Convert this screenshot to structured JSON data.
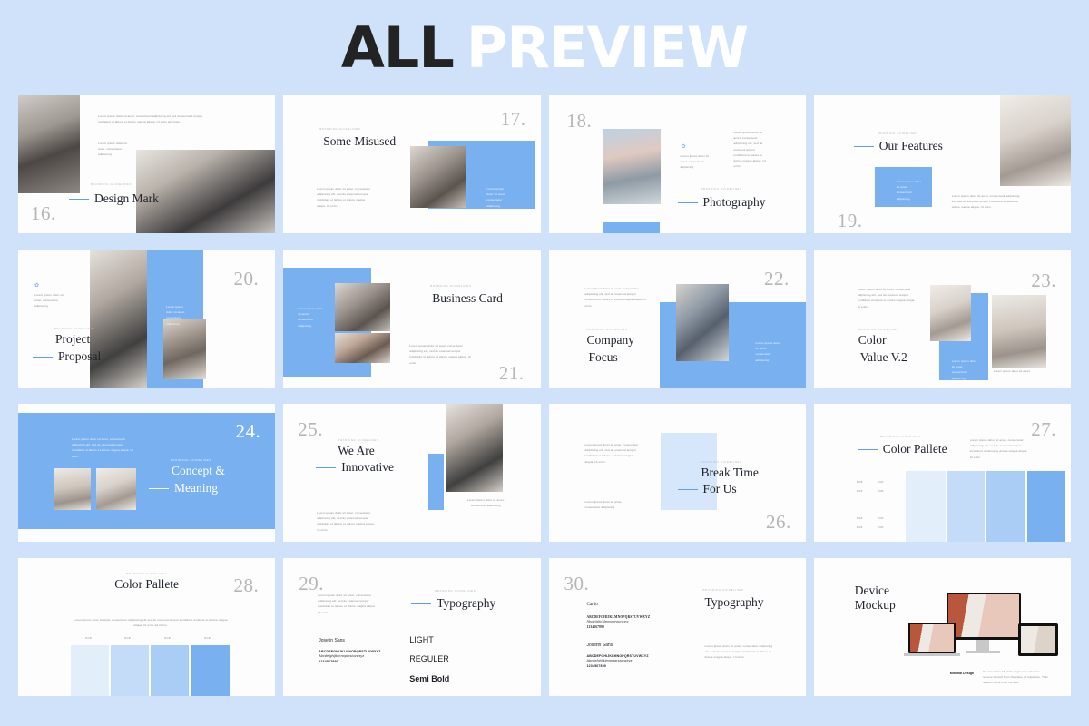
{
  "header": {
    "title_dark": "ALL",
    "title_light": "PREVIEW"
  },
  "common": {
    "eyebrow": "BRANDING GUIDELINES",
    "lorem_long": "Lorem ipsum dolor sit amet, consectetur adipiscing elit sed do eiusmod tempor incididunt ut labore et dolore magna aliqua. Ut enim ad minim.",
    "lorem_mid": "Lorem ipsum dolor sit amet, consectetur adipiscing elit, sed do eiusmod tempor incididunt ut labore et dolore magna aliqua. Ut enim.",
    "lorem_short": "Lorem ipsum dolor sit amet, consectetur adipiscing",
    "lorem_block": "Lorem ipsum dolor sit amet, consectetur adipiscing",
    "lorem_xshort": "Lorem ipsum dolor sit amet",
    "rgb_label": "RGB"
  },
  "slides": [
    {
      "number": "16.",
      "title": "Design Mark",
      "eyebrow": "BRANDING GUIDELINES"
    },
    {
      "number": "17.",
      "title": "Some Misused",
      "eyebrow": "BRANDING GUIDELINES"
    },
    {
      "number": "18.",
      "title": "Photography",
      "eyebrow": "BRANDING GUIDELINES"
    },
    {
      "number": "19.",
      "title": "Our Features",
      "eyebrow": "BRANDING GUIDELINES"
    },
    {
      "number": "20.",
      "title_line1": "Project",
      "title_line2": "Proposal",
      "eyebrow": "BRANDING GUIDELINES"
    },
    {
      "number": "21.",
      "title": "Business Card",
      "eyebrow": "BRANDING GUIDELINES"
    },
    {
      "number": "22.",
      "title_line1": "Company",
      "title_line2": "Focus",
      "eyebrow": "BRANDING GUIDELINES"
    },
    {
      "number": "23.",
      "title_line1": "Color",
      "title_line2": "Value V.2",
      "eyebrow": "BRANDING GUIDELINES"
    },
    {
      "number": "24.",
      "title_line1": "Concept &",
      "title_line2": "Meaning",
      "eyebrow": "BRANDING GUIDELINES"
    },
    {
      "number": "25.",
      "title_line1": "We Are",
      "title_line2": "Innovative",
      "eyebrow": "BRANDING GUIDELINES"
    },
    {
      "number": "26.",
      "title_line1": "Break Time",
      "title_line2": "For Us",
      "eyebrow": "BRANDING GUIDELINES"
    },
    {
      "number": "27.",
      "title": "Color Pallete",
      "eyebrow": "BRANDING GUIDELINES"
    },
    {
      "number": "28.",
      "title": "Color Pallete",
      "eyebrow": "BRANDING GUIDELINES"
    },
    {
      "number": "29.",
      "title": "Typography",
      "eyebrow": "BRANDING GUIDELINES"
    },
    {
      "number": "30.",
      "title": "Typography",
      "eyebrow": "BRANDING GUIDELINES"
    },
    {
      "number": "",
      "title_line1": "Device",
      "title_line2": "Mockup",
      "eyebrow": ""
    }
  ],
  "palette": {
    "swatches": [
      {
        "label": "RGB",
        "color": "#e3eefb"
      },
      {
        "label": "RGB",
        "color": "#c5dcf8"
      },
      {
        "label": "RGB",
        "color": "#a9cdf5"
      },
      {
        "label": "RGB",
        "color": "#79b0f0"
      }
    ],
    "accent": "#79b0f0",
    "background": "#cfe2f9"
  },
  "typography": {
    "font_primary": "Josefin Sans",
    "font_secondary": "Cardo",
    "uppercase": "ABCDEFGHIJKLMNOPQRSTUVWXYZ",
    "lowercase": "Abcdefghijklmnopqrstuvwxyz",
    "numerals": "1234567890",
    "weights": [
      "LIGHT",
      "REGULER",
      "Semi Bold"
    ]
  },
  "device": {
    "caption_title": "Minimal Design",
    "caption_body": "On november 13, Julia angor was asked to remove himself from the place of residence. That request came from his wife."
  }
}
